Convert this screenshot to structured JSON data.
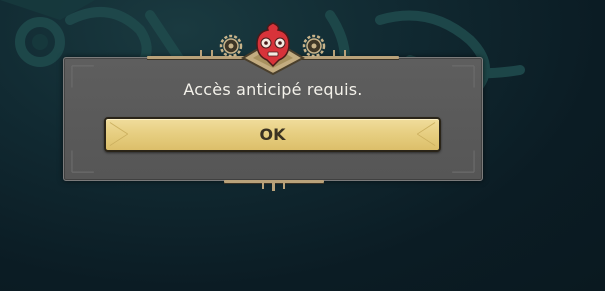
{
  "dialog": {
    "message": "Accès anticipé requis.",
    "ok_label": "OK"
  },
  "icons": {
    "top": "mask-emblem-icon",
    "left_gear": "gear-icon",
    "right_gear": "gear-icon"
  },
  "colors": {
    "background": "#0c1e26",
    "dialog_panel": "#5a5a5a",
    "button_fill": "#e7cf82",
    "button_text": "#3a3222",
    "message_text": "#f3f1ea",
    "emblem_red": "#d8333a"
  }
}
